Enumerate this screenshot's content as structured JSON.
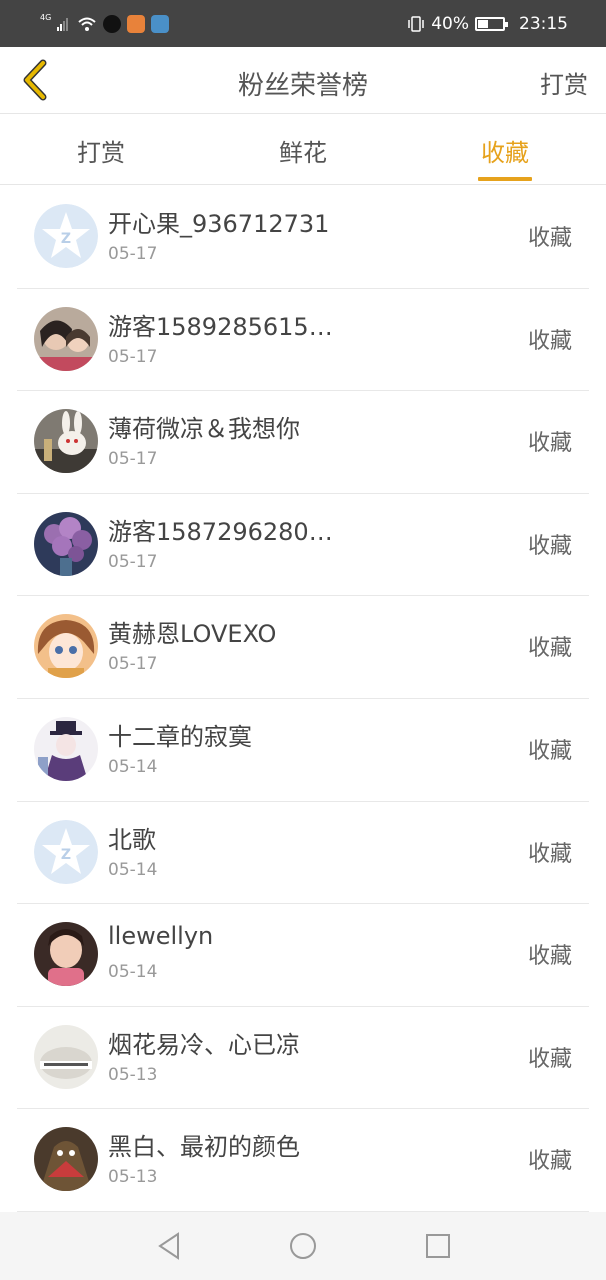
{
  "status_bar": {
    "network": "4G",
    "battery": "40%",
    "battery_level": 0.4,
    "time": "23:15",
    "colors": {
      "background": "#444444"
    }
  },
  "header": {
    "title": "粉丝荣誉榜",
    "right_action": "打赏",
    "back_icon": "chevron-left-icon",
    "back_color": "#e6b800"
  },
  "tabs": [
    {
      "label": "打赏",
      "active": false
    },
    {
      "label": "鲜花",
      "active": false
    },
    {
      "label": "收藏",
      "active": true
    }
  ],
  "accent_color": "#e6a21c",
  "fans": [
    {
      "name": "开心果_936712731",
      "date": "05-17",
      "action": "收藏",
      "avatar": "default-star-avatar"
    },
    {
      "name": "游客1589285615…",
      "date": "05-17",
      "action": "收藏",
      "avatar": "photo-avatar"
    },
    {
      "name": "薄荷微凉＆我想你",
      "date": "05-17",
      "action": "收藏",
      "avatar": "bunny-photo-avatar"
    },
    {
      "name": "游客1587296280…",
      "date": "05-17",
      "action": "收藏",
      "avatar": "flowers-photo-avatar"
    },
    {
      "name": "黄赫恩LOVEXO",
      "date": "05-17",
      "action": "收藏",
      "avatar": "anime-girl-avatar"
    },
    {
      "name": "十二章的寂寞",
      "date": "05-14",
      "action": "收藏",
      "avatar": "anime-character-avatar"
    },
    {
      "name": "北歌",
      "date": "05-14",
      "action": "收藏",
      "avatar": "default-star-avatar"
    },
    {
      "name": "llewellyn",
      "date": "05-14",
      "action": "收藏",
      "avatar": "child-photo-avatar"
    },
    {
      "name": "烟花易冷、心已凉",
      "date": "05-13",
      "action": "收藏",
      "avatar": "stone-photo-avatar"
    },
    {
      "name": "黑白、最初的颜色",
      "date": "05-13",
      "action": "收藏",
      "avatar": "dark-photo-avatar"
    }
  ],
  "nav_bar": {
    "buttons": [
      "back-triangle-icon",
      "home-circle-icon",
      "recents-square-icon"
    ]
  }
}
